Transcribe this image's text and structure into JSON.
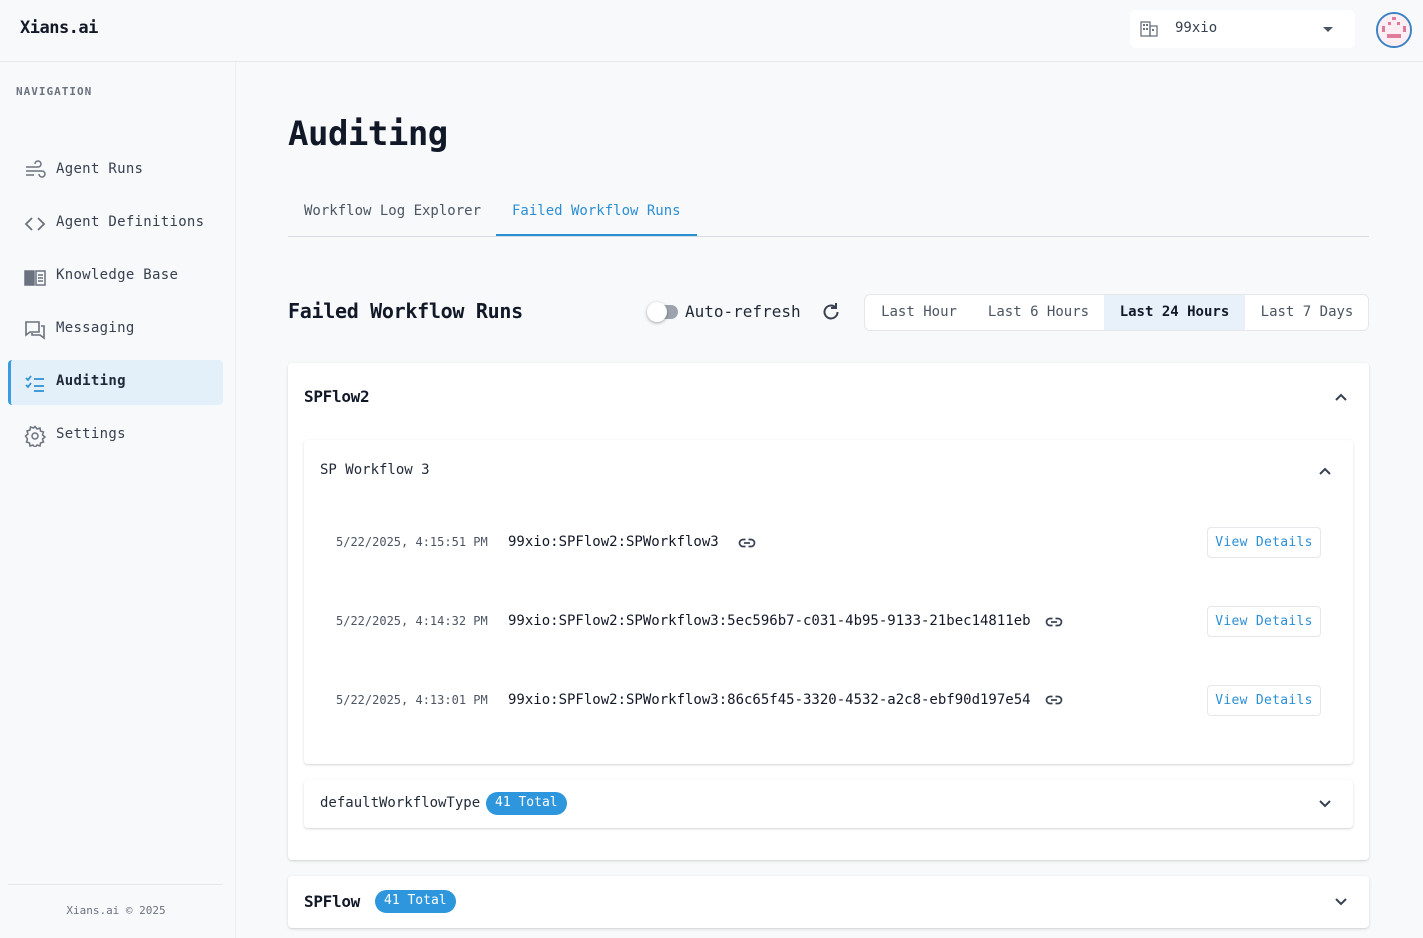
{
  "app": {
    "logo": "Xians.ai"
  },
  "tenant": {
    "name": "99xio",
    "icon": "building-icon"
  },
  "sidebar": {
    "title": "NAVIGATION",
    "items": [
      {
        "label": "Agent Runs",
        "icon": "wind-flow-icon"
      },
      {
        "label": "Agent Definitions",
        "icon": "code-brackets-icon"
      },
      {
        "label": "Knowledge Base",
        "icon": "book-icon"
      },
      {
        "label": "Messaging",
        "icon": "chat-icon"
      },
      {
        "label": "Auditing",
        "icon": "checklist-icon",
        "active": true
      },
      {
        "label": "Settings",
        "icon": "gear-icon"
      }
    ],
    "footer": "Xians.ai © 2025"
  },
  "page": {
    "title": "Auditing",
    "tabs": [
      {
        "label": "Workflow Log Explorer"
      },
      {
        "label": "Failed Workflow Runs",
        "active": true
      }
    ]
  },
  "failed": {
    "title": "Failed Workflow Runs",
    "auto_refresh_label": "Auto-refresh",
    "auto_refresh_on": false,
    "ranges": [
      {
        "label": "Last Hour"
      },
      {
        "label": "Last 6 Hours"
      },
      {
        "label": "Last 24 Hours",
        "active": true
      },
      {
        "label": "Last 7 Days"
      }
    ],
    "accent_color": "#2e96dc"
  },
  "groups": [
    {
      "name": "SPFlow2",
      "expanded": true,
      "workflows": [
        {
          "name": "SP Workflow 3",
          "expanded": true,
          "runs": [
            {
              "time": "5/22/2025, 4:15:51 PM",
              "id": "99xio:SPFlow2:SPWorkflow3",
              "action": "View Details"
            },
            {
              "time": "5/22/2025, 4:14:32 PM",
              "id": "99xio:SPFlow2:SPWorkflow3:5ec596b7-c031-4b95-9133-21bec14811eb",
              "action": "View Details"
            },
            {
              "time": "5/22/2025, 4:13:01 PM",
              "id": "99xio:SPFlow2:SPWorkflow3:86c65f45-3320-4532-a2c8-ebf90d197e54",
              "action": "View Details"
            }
          ]
        },
        {
          "name": "defaultWorkflowType",
          "badge": "41 Total",
          "expanded": false
        }
      ]
    },
    {
      "name": "SPFlow",
      "badge": "41 Total",
      "expanded": false
    }
  ]
}
